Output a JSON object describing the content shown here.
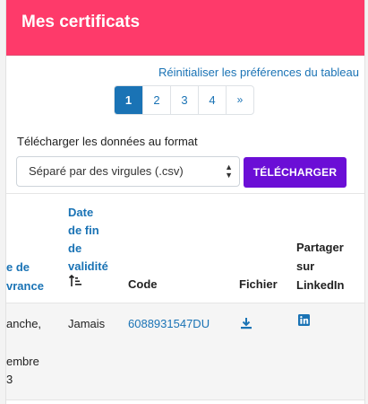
{
  "header": {
    "title": "Mes certificats"
  },
  "table_tools": {
    "reset_link": "Réinitialiser les préférences du tableau",
    "pagination": {
      "pages": [
        "1",
        "2",
        "3",
        "4"
      ],
      "active": "1",
      "next": "»"
    },
    "download_label": "Télécharger les données au format",
    "format_select": {
      "selected": "Séparé par des virgules (.csv)"
    },
    "download_button": "TÉLÉCHARGER"
  },
  "table": {
    "columns": {
      "delivery_date": [
        "e de",
        "vrance"
      ],
      "end_date": [
        "Date",
        "de fin",
        "de",
        "validité"
      ],
      "code": "Code",
      "file": "Fichier",
      "share": [
        "Partager",
        "sur",
        "LinkedIn"
      ]
    },
    "rows": [
      {
        "delivery_date": [
          "anche,",
          "embre",
          "3"
        ],
        "end_date": "Jamais",
        "code": "6088931547DU"
      }
    ]
  },
  "colors": {
    "header_bg": "#fe3a6a",
    "accent": "#1a73b5",
    "button": "#6b0ed6"
  },
  "icons": {
    "sort": "sort-ascending-icon",
    "download": "download-icon",
    "linkedin": "linkedin-icon"
  }
}
